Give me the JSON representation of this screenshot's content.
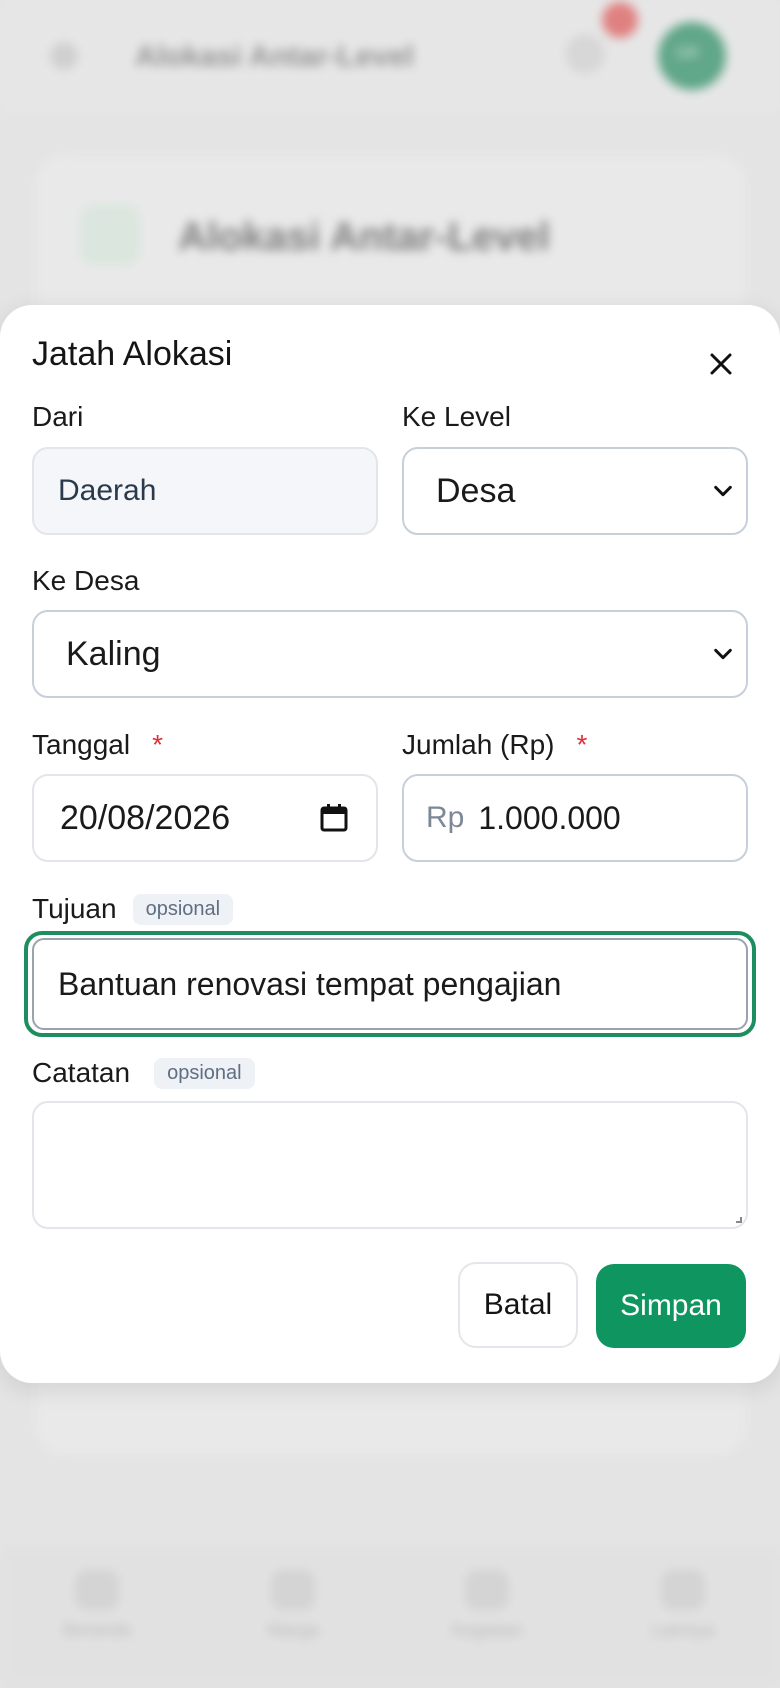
{
  "background": {
    "header_title": "Alokasi Antar-Level",
    "avatar_initials": "DR",
    "card_title": "Alokasi Antar-Level",
    "nav": [
      "Beranda",
      "Warga",
      "Kegiatan",
      "Lainnya"
    ]
  },
  "modal": {
    "title": "Jatah Alokasi",
    "dari": {
      "label": "Dari",
      "value": "Daerah"
    },
    "ke_level": {
      "label": "Ke Level",
      "value": "Desa"
    },
    "ke_desa": {
      "label": "Ke Desa",
      "value": "Kaling"
    },
    "tanggal": {
      "label": "Tanggal",
      "required_mark": "*",
      "value": "20/08/2026"
    },
    "jumlah": {
      "label": "Jumlah (Rp)",
      "required_mark": "*",
      "prefix": "Rp",
      "value": "1.000.000"
    },
    "tujuan": {
      "label": "Tujuan",
      "optional_tag": "opsional",
      "value": "Bantuan renovasi tempat pengajian"
    },
    "catatan": {
      "label": "Catatan",
      "optional_tag": "opsional",
      "value": ""
    },
    "buttons": {
      "cancel": "Batal",
      "save": "Simpan"
    }
  },
  "colors": {
    "primary": "#0f9660",
    "required": "#e0313b",
    "badge": "#e25050"
  }
}
